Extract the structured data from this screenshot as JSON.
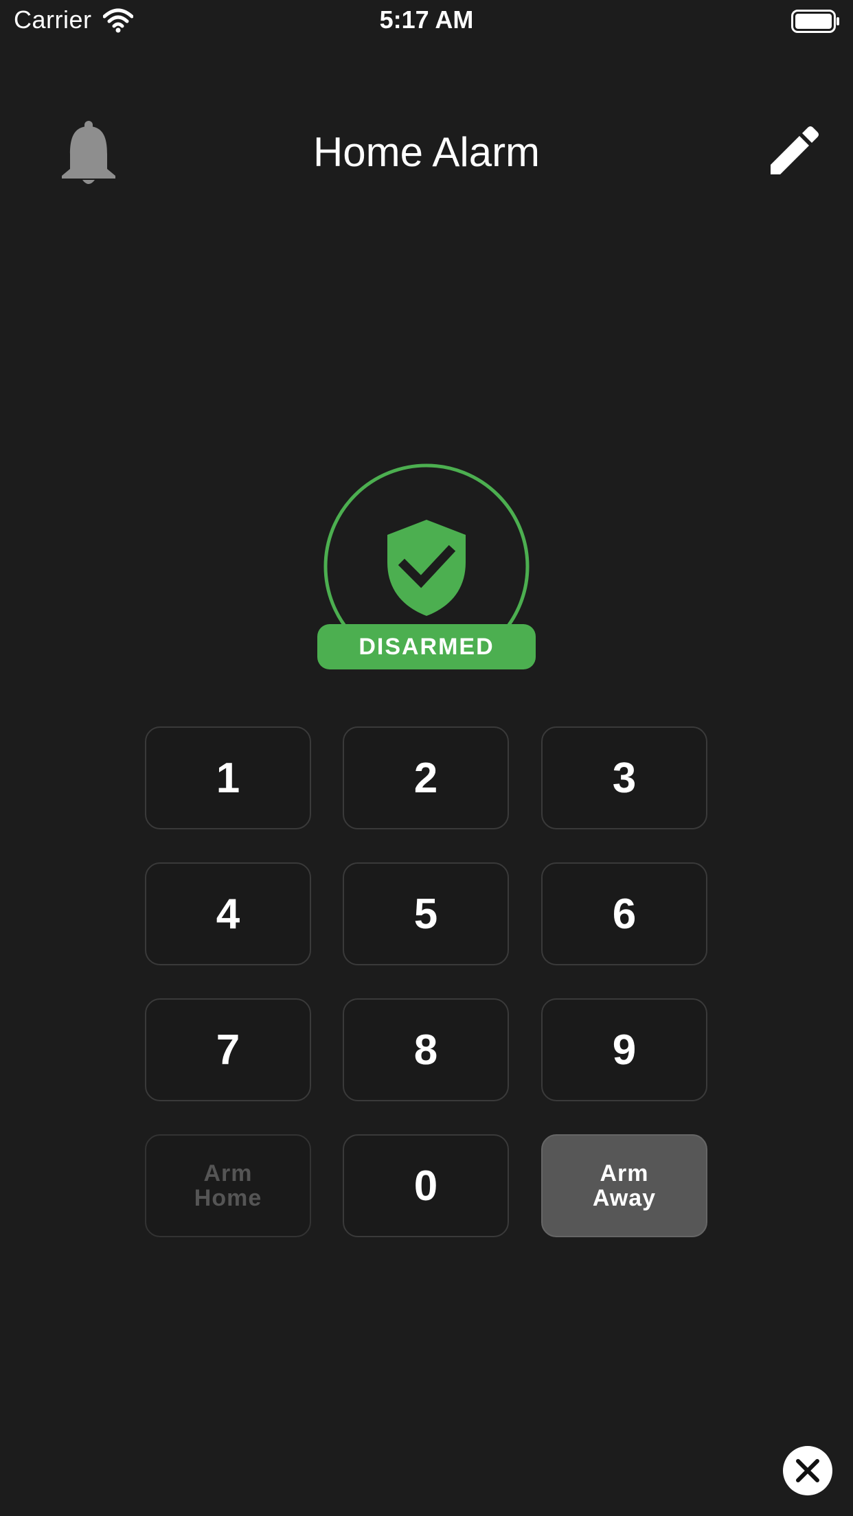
{
  "status_bar": {
    "carrier": "Carrier",
    "time": "5:17 AM",
    "icons": [
      "wifi-icon",
      "battery-icon"
    ]
  },
  "header": {
    "title": "Home Alarm",
    "left_icon": "bell-icon",
    "right_icon": "edit-icon"
  },
  "status": {
    "label": "DISARMED",
    "icon": "shield-check-icon",
    "color": "#4caf50"
  },
  "keypad": {
    "keys": {
      "k1": "1",
      "k2": "2",
      "k3": "3",
      "k4": "4",
      "k5": "5",
      "k6": "6",
      "k7": "7",
      "k8": "8",
      "k9": "9",
      "k0": "0",
      "arm_home": "Arm\nHome",
      "arm_away": "Arm\nAway"
    },
    "arm_home_state": "disabled",
    "arm_away_state": "active"
  },
  "close": {
    "icon": "close-icon"
  },
  "colors": {
    "background": "#1c1c1c",
    "accent": "#4caf50",
    "key_border": "#3a3a3a",
    "active_key": "#575757"
  }
}
